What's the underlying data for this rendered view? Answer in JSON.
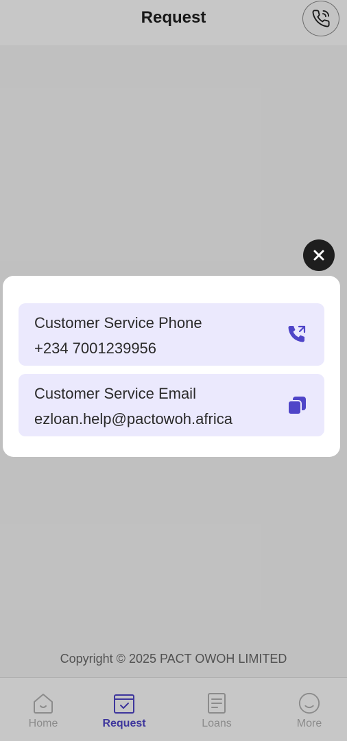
{
  "header": {
    "title": "Request",
    "phone_icon": "phone-icon"
  },
  "footer": {
    "copyright": "Copyright © 2025 PACT OWOH LIMITED"
  },
  "tabs": [
    {
      "label": "Home",
      "icon": "home-icon",
      "active": false
    },
    {
      "label": "Request",
      "icon": "request-icon",
      "active": true
    },
    {
      "label": "Loans",
      "icon": "document-icon",
      "active": false
    },
    {
      "label": "More",
      "icon": "smile-icon",
      "active": false
    }
  ],
  "modal": {
    "phone": {
      "label": "Customer Service Phone",
      "value": "+234 7001239956",
      "icon": "call-icon"
    },
    "email": {
      "label": "Customer Service Email",
      "value": "ezloan.help@pactowoh.africa",
      "icon": "copy-icon"
    },
    "close_icon": "close-icon"
  },
  "colors": {
    "accent": "#4f45c8",
    "card_background": "#ebe9fd",
    "inactive_tab": "#b3b3b3"
  }
}
